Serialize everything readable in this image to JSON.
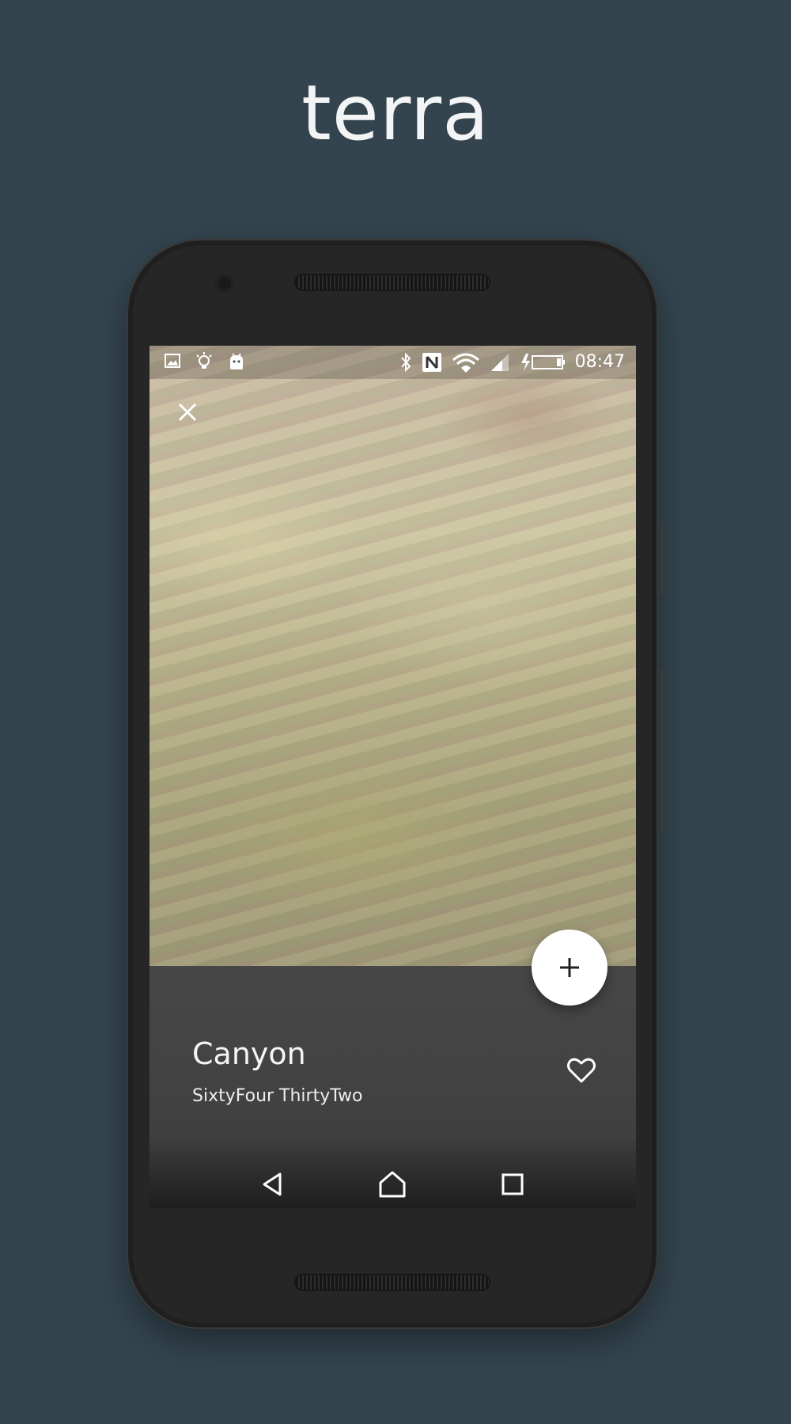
{
  "header": {
    "app_name": "terra"
  },
  "status_bar": {
    "time": "08:47",
    "left_icons": [
      "image-icon",
      "lightbulb-icon",
      "android-icon"
    ],
    "right_icons": [
      "bluetooth-icon",
      "nfc-icon",
      "wifi-icon",
      "signal-icon",
      "battery-charging-icon"
    ]
  },
  "wallpaper": {
    "title": "Canyon",
    "author": "SixtyFour ThirtyTwo"
  },
  "actions": {
    "close_icon": "close-icon",
    "fab_icon": "plus-icon",
    "favorite_icon": "heart-icon"
  },
  "nav": {
    "icons": [
      "back-icon",
      "home-icon",
      "recents-icon"
    ]
  },
  "colors": {
    "background": "#33444e",
    "panel": "#444444",
    "fab": "#ffffff",
    "text": "#f5f5f5"
  }
}
